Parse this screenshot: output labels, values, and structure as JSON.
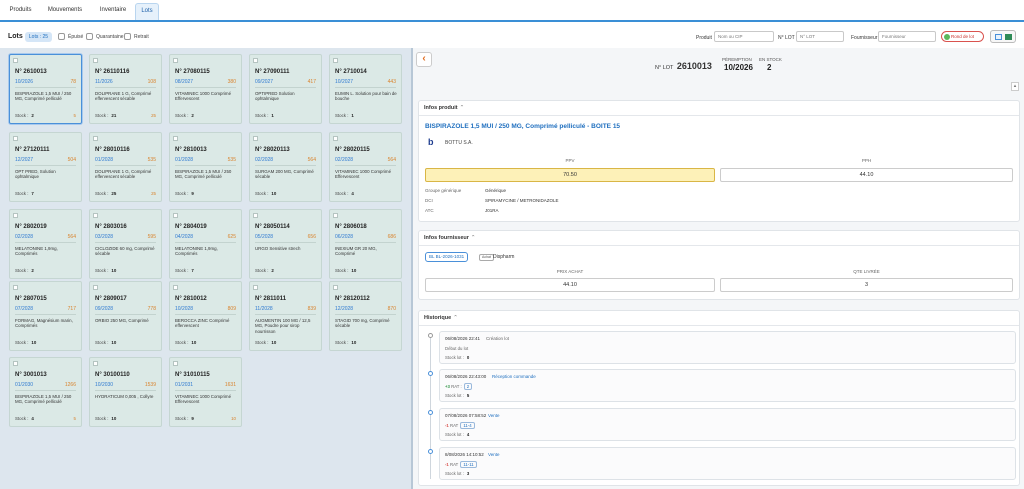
{
  "tabs": [
    "Produits",
    "Mouvements",
    "Inventaire",
    "Lots"
  ],
  "toolbar": {
    "title": "Lots",
    "count_badge": "Lots : 25",
    "filters": [
      "Épuisé",
      "Quarantaine",
      "Retrait"
    ],
    "produit_label": "Produit",
    "produit_placeholder": "Nom ou CIP",
    "lot_label": "N° LOT",
    "lot_placeholder": "N° LOT",
    "fournisseur_label": "Fournisseur",
    "fournisseur_placeholder": "Fournisseur",
    "stock_button": "Rond de lot"
  },
  "lots": [
    {
      "num": "N° 2610013",
      "exp": "10/2026",
      "count": "78",
      "name": "BISPIRAZOLE 1,5 MUI / 250 MG, Comprimé pelliculé",
      "stock": "2",
      "extra": "5"
    },
    {
      "num": "N° 26110116",
      "exp": "11/2026",
      "count": "108",
      "name": "DOLIPRANE 1 G, Comprimé effervescent sécable",
      "stock": "21",
      "extra": "25"
    },
    {
      "num": "N° 27080115",
      "exp": "08/2027",
      "count": "380",
      "name": "VITAMINEC 1000 Comprimé Effervescent",
      "stock": "2",
      "extra": ""
    },
    {
      "num": "N° 27090111",
      "exp": "09/2027",
      "count": "417",
      "name": "OPTIPRED Solution ophtalmique",
      "stock": "1",
      "extra": ""
    },
    {
      "num": "N° 2710014",
      "exp": "10/2027",
      "count": "443",
      "name": "EUMIN L. Solution pour bain de bouche",
      "stock": "1",
      "extra": ""
    },
    {
      "num": "N° 27120111",
      "exp": "12/2027",
      "count": "504",
      "name": "OPT PRED, Solution ophtalmique",
      "stock": "7",
      "extra": ""
    },
    {
      "num": "N° 28010116",
      "exp": "01/2028",
      "count": "535",
      "name": "DOLIPRANE 1 G, Comprimé effervescent sécable",
      "stock": "25",
      "extra": "25"
    },
    {
      "num": "N° 2810013",
      "exp": "01/2028",
      "count": "535",
      "name": "BISPIRAZOLE 1,5 MUI / 250 MG, Comprimé pelliculé",
      "stock": "9",
      "extra": ""
    },
    {
      "num": "N° 28020113",
      "exp": "02/2028",
      "count": "564",
      "name": "SURGAM 200 MG, Comprimé sécable",
      "stock": "10",
      "extra": ""
    },
    {
      "num": "N° 28020115",
      "exp": "02/2028",
      "count": "564",
      "name": "VITAMINEC 1000 Comprimé Effervescent",
      "stock": "4",
      "extra": ""
    },
    {
      "num": "N° 2802019",
      "exp": "02/2028",
      "count": "564",
      "name": "MELATONINE 1,9mg, Comprimés",
      "stock": "2",
      "extra": ""
    },
    {
      "num": "N° 2803016",
      "exp": "03/2028",
      "count": "595",
      "name": "CICLOZIDE 60 mg, Comprimé sécable",
      "stock": "10",
      "extra": ""
    },
    {
      "num": "N° 2804019",
      "exp": "04/2028",
      "count": "625",
      "name": "MELATONINE 1,9mg, Comprimés",
      "stock": "7",
      "extra": ""
    },
    {
      "num": "N° 28050114",
      "exp": "05/2028",
      "count": "656",
      "name": "URGO Sensitive strech",
      "stock": "2",
      "extra": ""
    },
    {
      "num": "N° 2806018",
      "exp": "06/2028",
      "count": "686",
      "name": "INEXIUM GR 20 MG, Comprimé",
      "stock": "10",
      "extra": ""
    },
    {
      "num": "N° 2807015",
      "exp": "07/2028",
      "count": "717",
      "name": "FORMAG, Magnésium marin, Comprimés",
      "stock": "10",
      "extra": ""
    },
    {
      "num": "N° 2809017",
      "exp": "09/2028",
      "count": "778",
      "name": "ORBIO 250 MG, Comprimé",
      "stock": "10",
      "extra": ""
    },
    {
      "num": "N° 2810012",
      "exp": "10/2028",
      "count": "809",
      "name": "BEROCCA ZINC Comprimé effervescent",
      "stock": "10",
      "extra": ""
    },
    {
      "num": "N° 2811011",
      "exp": "11/2028",
      "count": "839",
      "name": "AUGMENTIN 100 MG / 12,5 MG, Poudre pour sirop nourrisson",
      "stock": "10",
      "extra": ""
    },
    {
      "num": "N° 28120112",
      "exp": "12/2028",
      "count": "870",
      "name": "STAGID 700 mg, Comprimé sécable",
      "stock": "10",
      "extra": ""
    },
    {
      "num": "N° 3001013",
      "exp": "01/2030",
      "count": "1266",
      "name": "BISPIRAZOLE 1,5 MUI / 250 MG, Comprimé pelliculé",
      "stock": "4",
      "extra": "5"
    },
    {
      "num": "N° 30100110",
      "exp": "10/2030",
      "count": "1539",
      "name": "HYDRATICUM 0,005 , Collyre",
      "stock": "10",
      "extra": ""
    },
    {
      "num": "N° 31010115",
      "exp": "01/2031",
      "count": "1631",
      "name": "VITAMINEC 1000 Comprimé Effervescent",
      "stock": "9",
      "extra": "10"
    }
  ],
  "detail": {
    "peremption_label": "PÉREMPTION",
    "peremption": "10/2026",
    "stock_label": "EN STOCK",
    "stock": "2",
    "lot_label": "N° LOT",
    "lot": "2610013",
    "infos_produit": {
      "title": "Infos produit",
      "product": "BISPIRAZOLE 1,5 MUI / 250 MG, Comprimé pelliculé - BOITE 15",
      "lab": "BOTTU S.A.",
      "ppv_label": "PPV",
      "ppv": "70.50",
      "pph_label": "PPH",
      "pph": "44.10",
      "rows": [
        {
          "k": "Groupe générique",
          "v": "Générique"
        },
        {
          "k": "DCI",
          "v": "SPIRAMYCINE / METRONIDAZOLE"
        },
        {
          "k": "ATC",
          "v": "J01RA"
        }
      ]
    },
    "infos_fournisseur": {
      "title": "Infos fournisseur",
      "bl": "BL BL-2026-1031",
      "tag": "Achat",
      "supplier": "Dispharm",
      "prix_label": "PRIX ACHAT",
      "prix": "44.10",
      "qte_label": "QTE LIVRÉE",
      "qte": "3"
    },
    "historique": {
      "title": "Historique",
      "events": [
        {
          "date": "06/08/2026 22:41",
          "type": "Création lot",
          "r2": "Début du lot",
          "qty": "",
          "tag": "",
          "stock_label": "Stock lot :",
          "stock": "0"
        },
        {
          "date": "06/08/2026 22:43:00",
          "type": "Réception commande",
          "r2": "RAT :",
          "qty": "+3",
          "tag": "2",
          "stock_label": "Stock lot :",
          "stock": "5"
        },
        {
          "date": "07/08/2026 07:58:52",
          "type": "Vente",
          "r2": "RAT",
          "qty": "-1",
          "tag": "11-4",
          "stock_label": "Stock lot :",
          "stock": "4"
        },
        {
          "date": "8/08/2026 14:10:52",
          "type": "Vente",
          "r2": "RAT",
          "qty": "-1",
          "tag": "11-11",
          "stock_label": "Stock lot :",
          "stock": "3"
        }
      ]
    }
  }
}
